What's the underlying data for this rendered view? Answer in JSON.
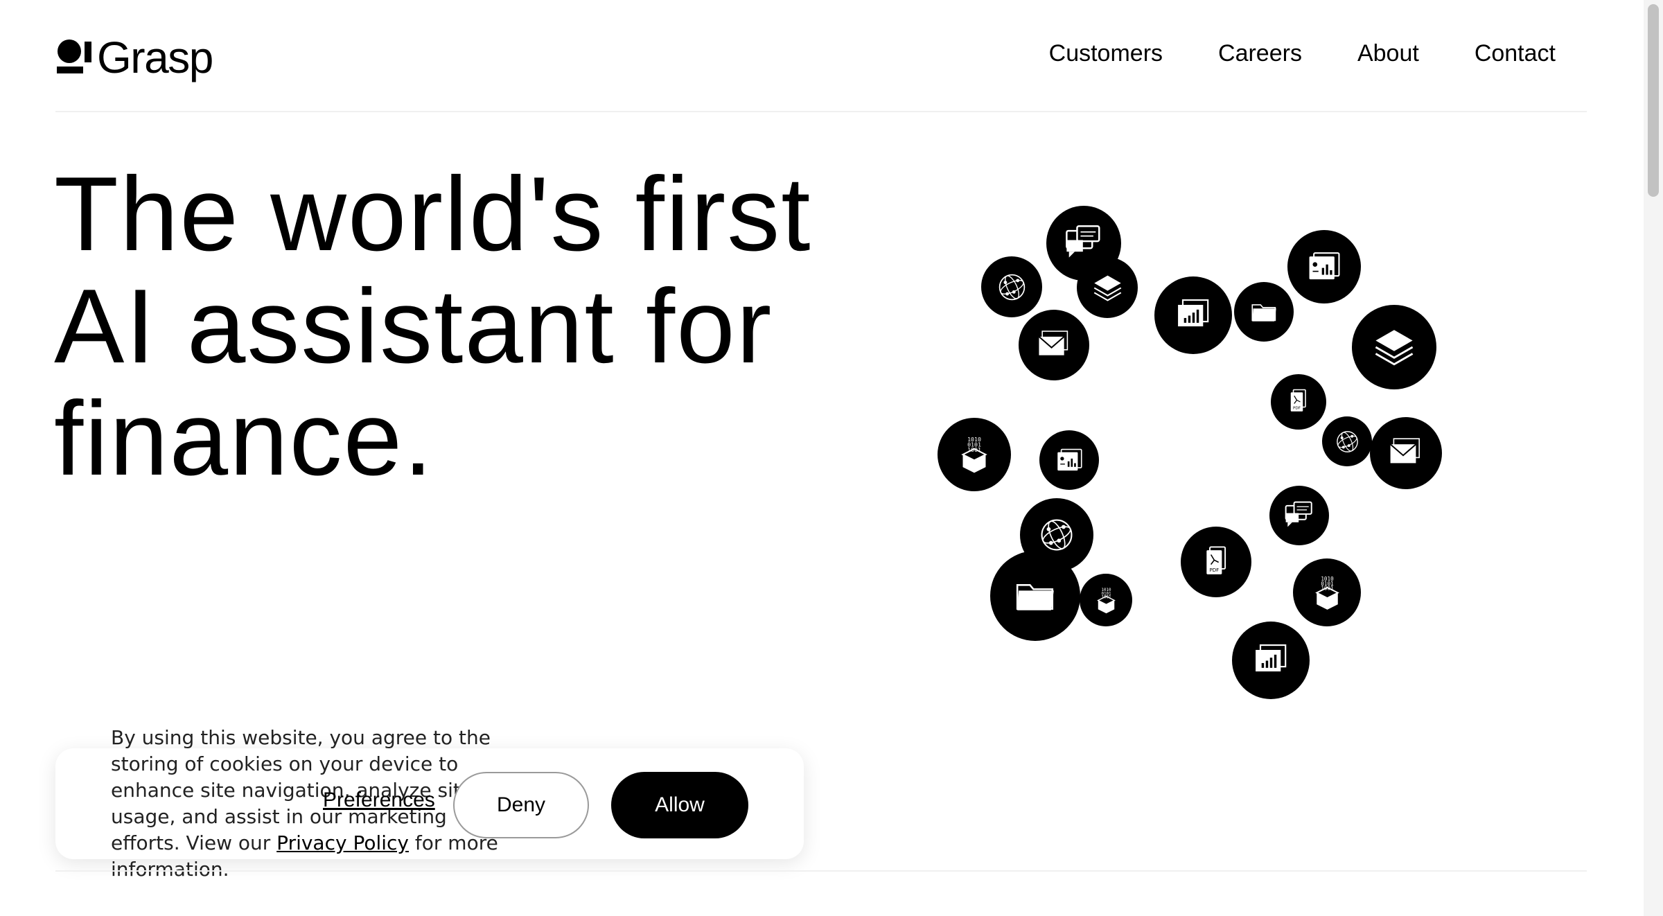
{
  "brand": {
    "name": "Grasp",
    "logo_icon": "grasp-mark-icon"
  },
  "nav": {
    "items": [
      "Customers",
      "Careers",
      "About",
      "Contact"
    ]
  },
  "hero": {
    "line1": "The world's first",
    "line2": "AI assistant for",
    "line3": "finance."
  },
  "bubble_icons": [
    "chat-icon",
    "globe-icon",
    "layers-icon",
    "mail-icon",
    "chart-icon",
    "folder-icon",
    "report-icon",
    "pdf-icon",
    "binary-box-icon"
  ],
  "cookie": {
    "text_before": "By using this website, you agree to the storing of cookies on your device to enhance site navigation, analyze site usage, and assist in our marketing efforts. View our ",
    "privacy_link": "Privacy Policy",
    "text_after": " for more information.",
    "preferences": "Preferences",
    "deny": "Deny",
    "allow": "Allow"
  },
  "colors": {
    "background": "#ffffff",
    "text": "#000000",
    "bubble": "#000000",
    "allow_button": "#000000"
  }
}
